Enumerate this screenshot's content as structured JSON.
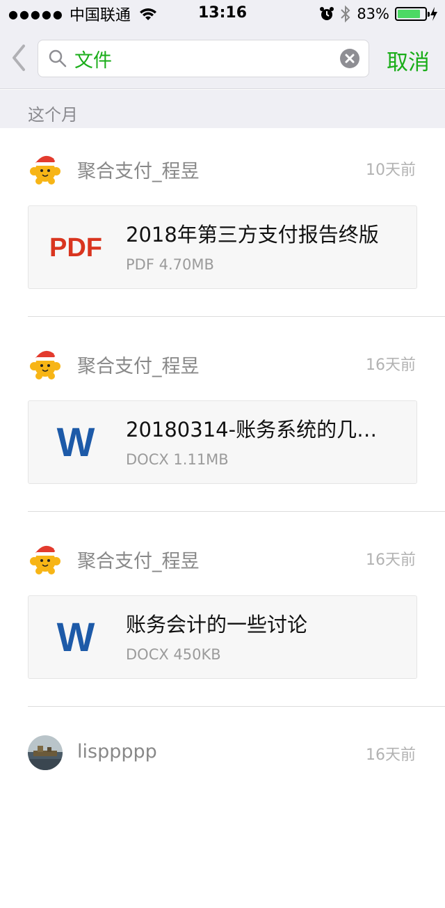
{
  "status_bar": {
    "signal": "●●●●●",
    "carrier": "中国联通",
    "time": "13:16",
    "battery": "83%",
    "battery_level": 0.83,
    "battery_color": "#4cd964"
  },
  "search": {
    "query": "文件",
    "cancel_label": "取消",
    "accent_color": "#1aad19"
  },
  "section": {
    "title": "这个月"
  },
  "messages": [
    {
      "sender": "聚合支付_程昱",
      "time": "10天前",
      "file_type_icon": "PDF",
      "file_name": "2018年第三方支付报告终版",
      "file_meta": "PDF 4.70MB"
    },
    {
      "sender": "聚合支付_程昱",
      "time": "16天前",
      "file_type_icon": "W",
      "file_name": "20180314-账务系统的几…",
      "file_meta": "DOCX 1.11MB"
    },
    {
      "sender": "聚合支付_程昱",
      "time": "16天前",
      "file_type_icon": "W",
      "file_name": "账务会计的一些讨论",
      "file_meta": "DOCX 450KB"
    },
    {
      "sender": "lisppppp",
      "time": "16天前"
    }
  ]
}
